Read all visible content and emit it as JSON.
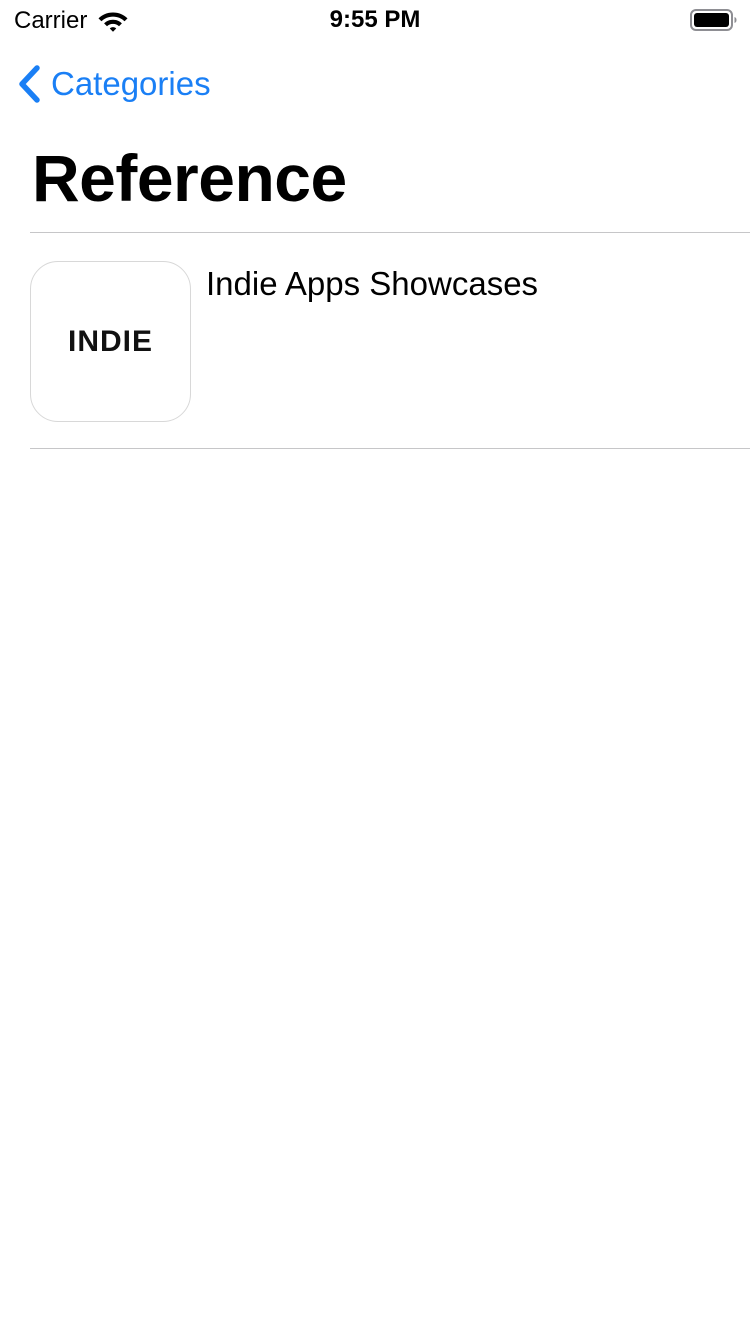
{
  "status_bar": {
    "carrier": "Carrier",
    "time": "9:55 PM",
    "wifi_icon": "wifi-icon",
    "battery_icon": "battery-full-icon"
  },
  "nav": {
    "back_label": "Categories",
    "back_icon": "chevron-left-icon",
    "title": "Reference",
    "accent_color": "#1a7ff5"
  },
  "list": {
    "items": [
      {
        "icon_text": "INDIE",
        "title": "Indie Apps Showcases"
      }
    ]
  }
}
